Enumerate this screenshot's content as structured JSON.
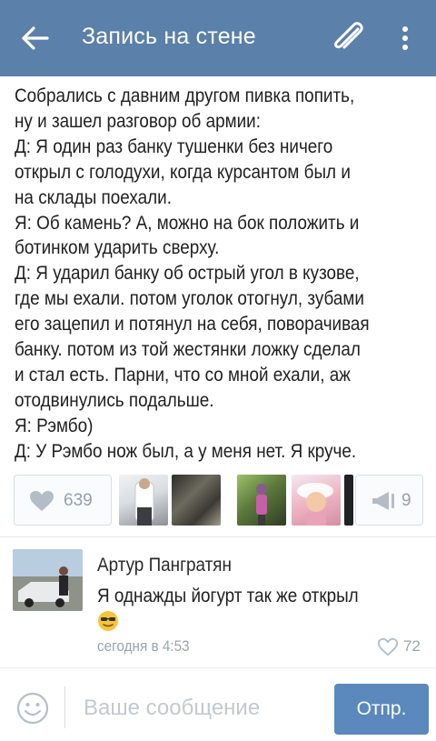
{
  "header": {
    "title": "Запись на стене",
    "back_icon": "arrow-left-icon",
    "attach_icon": "paperclip-icon",
    "menu_icon": "more-vertical-icon"
  },
  "post": {
    "lines": [
      "Собрались с давним другом пивка попить,",
      "ну и зашел разговор об армии:",
      "Д: Я один раз банку тушенки без ничего",
      "открыл с голодухи, когда курсантом был и",
      "на склады поехали.",
      "Я: Об камень? А, можно на бок положить и",
      "ботинком ударить сверху.",
      "Д: Я ударил банку об острый угол в кузове,",
      "где мы ехали. потом уголок отогнул, зубами",
      "его зацепил и потянул на себя, поворачивая",
      "банку. потом из той жестянки ложку сделал",
      "и стал есть. Парни, что со мной ехали, аж",
      "отодвинулись подальше.",
      "Я: Рэмбо)",
      "Д: У Рэмбо нож был, а у меня нет. Я круче."
    ]
  },
  "actions": {
    "likes": "639",
    "shares": "9",
    "like_icon": "heart-icon",
    "share_icon": "megaphone-icon"
  },
  "comment": {
    "author": "Артур Пангратян",
    "text": "Я однажды йогурт так же открыл",
    "emoji": "sunglasses-emoji-icon",
    "time": "сегодня в 4:53",
    "likes": "72"
  },
  "composer": {
    "placeholder": "Ваше сообщение",
    "send_label": "Отпр.",
    "smile_icon": "smile-icon"
  },
  "colors": {
    "header_bg": "#5b80a9",
    "send_bg": "#5b89be",
    "muted": "#93a1b0"
  }
}
